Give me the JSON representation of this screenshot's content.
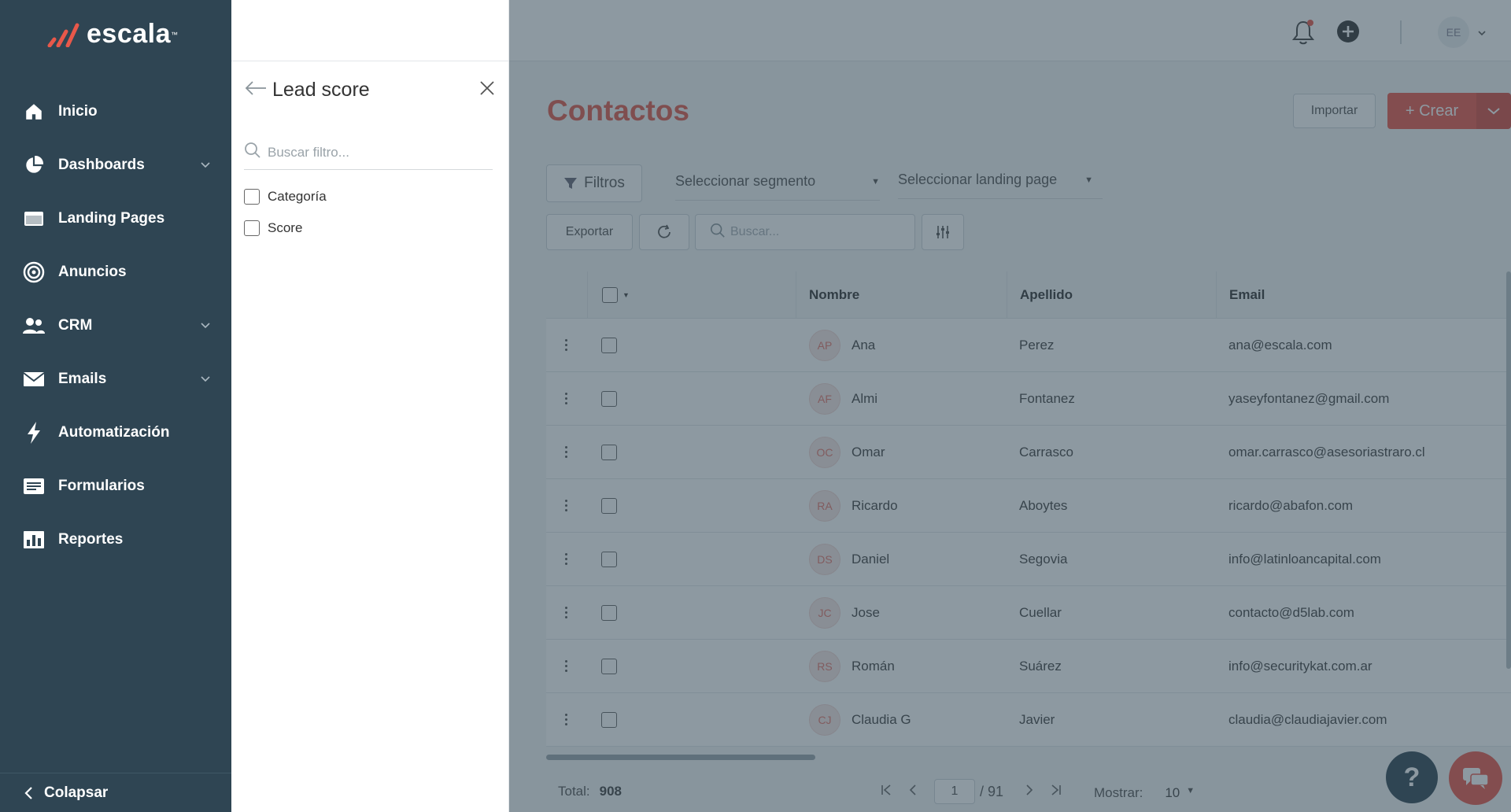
{
  "brand": {
    "name": "escala",
    "tm": "™"
  },
  "sidebar": {
    "items": [
      {
        "label": "Inicio",
        "icon": "home-icon",
        "expandable": false
      },
      {
        "label": "Dashboards",
        "icon": "pie-chart-icon",
        "expandable": true
      },
      {
        "label": "Landing Pages",
        "icon": "browser-window-icon",
        "expandable": false
      },
      {
        "label": "Anuncios",
        "icon": "target-icon",
        "expandable": false
      },
      {
        "label": "CRM",
        "icon": "users-icon",
        "expandable": true
      },
      {
        "label": "Emails",
        "icon": "envelope-icon",
        "expandable": true
      },
      {
        "label": "Automatización",
        "icon": "lightning-icon",
        "expandable": false
      },
      {
        "label": "Formularios",
        "icon": "form-icon",
        "expandable": false
      },
      {
        "label": "Reportes",
        "icon": "bar-chart-icon",
        "expandable": false
      }
    ],
    "collapse_label": "Colapsar"
  },
  "filter_panel": {
    "title": "Lead score",
    "search_placeholder": "Buscar filtro...",
    "options": [
      "Categoría",
      "Score"
    ]
  },
  "topbar": {
    "avatar_initials": "EE"
  },
  "main": {
    "title": "Contactos",
    "import_label": "Importar",
    "create_label": "+ Crear",
    "filters_label": "Filtros",
    "segment_placeholder": "Seleccionar segmento",
    "landing_placeholder": "Seleccionar landing page",
    "export_label": "Exportar",
    "search_placeholder": "Buscar..."
  },
  "table": {
    "columns": [
      "Nombre",
      "Apellido",
      "Email"
    ],
    "rows": [
      {
        "initials": "AP",
        "first": "Ana",
        "last": "Perez",
        "email": "ana@escala.com"
      },
      {
        "initials": "AF",
        "first": "Almi",
        "last": "Fontanez",
        "email": "yaseyfontanez@gmail.com"
      },
      {
        "initials": "OC",
        "first": "Omar",
        "last": "Carrasco",
        "email": "omar.carrasco@asesoriastraro.cl"
      },
      {
        "initials": "RA",
        "first": "Ricardo",
        "last": "Aboytes",
        "email": "ricardo@abafon.com"
      },
      {
        "initials": "DS",
        "first": "Daniel",
        "last": "Segovia",
        "email": "info@latinloancapital.com"
      },
      {
        "initials": "JC",
        "first": "Jose",
        "last": "Cuellar",
        "email": "contacto@d5lab.com"
      },
      {
        "initials": "RS",
        "first": "Román",
        "last": "Suárez",
        "email": "info@securitykat.com.ar"
      },
      {
        "initials": "CJ",
        "first": "Claudia G",
        "last": "Javier",
        "email": "claudia@claudiajavier.com"
      }
    ]
  },
  "footer": {
    "total_label": "Total:",
    "total_value": "908",
    "current_page": "1",
    "total_pages": "/ 91",
    "show_label": "Mostrar:",
    "show_value": "10"
  },
  "help_label": "?"
}
